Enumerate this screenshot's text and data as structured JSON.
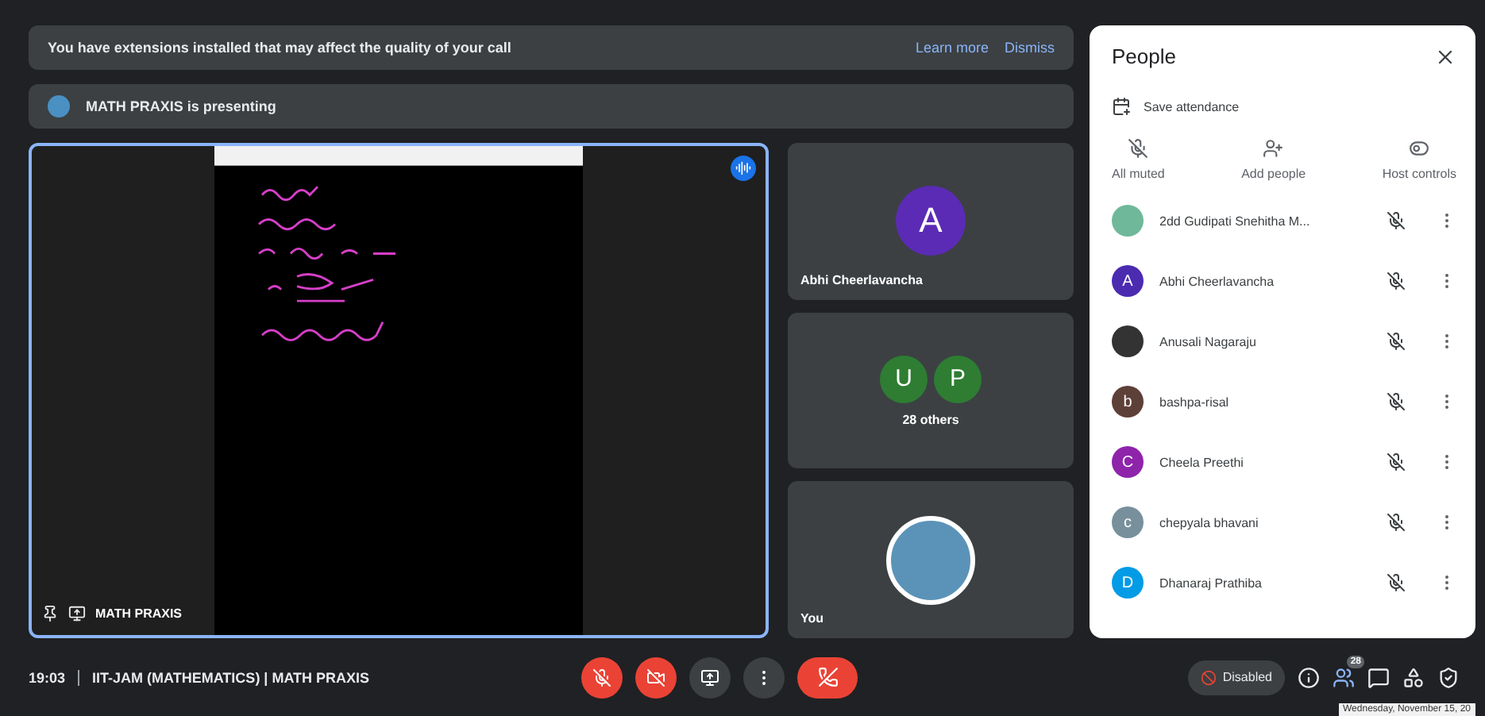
{
  "banner": {
    "text": "You have extensions installed that may affect the quality of your call",
    "actions": [
      "Learn more",
      "Dismiss"
    ]
  },
  "presenting": {
    "text": "MATH PRAXIS is presenting"
  },
  "main_tile": {
    "name": "MATH PRAXIS",
    "speaking": true
  },
  "side_tiles": [
    {
      "kind": "avatar",
      "name": "Abhi Cheerlavancha",
      "initial": "A",
      "color": "#5b2bb5"
    },
    {
      "kind": "group",
      "name": "28 others",
      "avatars": [
        {
          "initial": "U",
          "color": "#2e7d32"
        },
        {
          "initial": "P",
          "color": "#2e7d32"
        }
      ]
    },
    {
      "kind": "image",
      "name": "You"
    }
  ],
  "people": {
    "title": "People",
    "save_attendance": "Save attendance",
    "actions": [
      {
        "kind": "mute",
        "label": "All muted"
      },
      {
        "kind": "add",
        "label": "Add people"
      },
      {
        "kind": "host",
        "label": "Host controls"
      }
    ],
    "participants": [
      {
        "kind": "photo",
        "name": "2dd Gudipati Snehitha M...",
        "color": "#6fb89a"
      },
      {
        "kind": "letter",
        "name": "Abhi Cheerlavancha",
        "initial": "A",
        "color": "#4b2bb0"
      },
      {
        "kind": "photo",
        "name": "Anusali Nagaraju",
        "color": "#333333"
      },
      {
        "kind": "letter",
        "name": "bashpa-risal",
        "initial": "b",
        "color": "#5d4037"
      },
      {
        "kind": "letter",
        "name": "Cheela Preethi",
        "initial": "C",
        "color": "#8e24aa"
      },
      {
        "kind": "letter",
        "name": "chepyala bhavani",
        "initial": "c",
        "color": "#78909c"
      },
      {
        "kind": "letter",
        "name": "Dhanaraj Prathiba",
        "initial": "D",
        "color": "#039be5"
      }
    ]
  },
  "bottom": {
    "time": "19:03",
    "title": "IIT-JAM (MATHEMATICS) | MATH PRAXIS",
    "mic_muted": true,
    "camera_off": true,
    "captions": "Disabled",
    "people_count": "28",
    "date_tooltip": "Wednesday, November 15, 20"
  }
}
